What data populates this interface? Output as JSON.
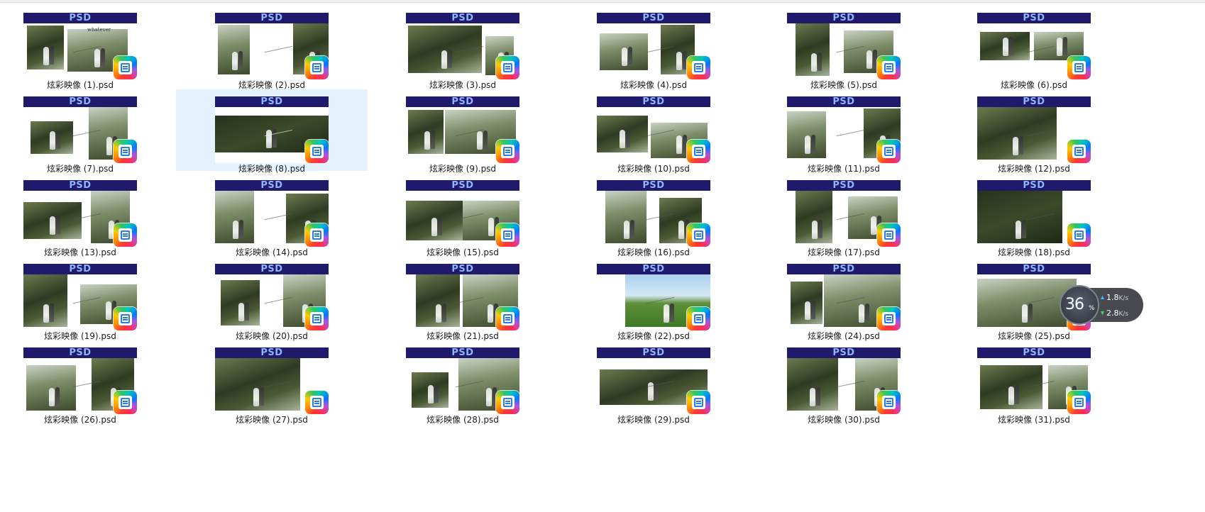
{
  "window": {
    "title": ""
  },
  "files": [
    {
      "name": "炫彩映像 (1).psd",
      "badge": "PSD"
    },
    {
      "name": "炫彩映像 (2).psd",
      "badge": "PSD"
    },
    {
      "name": "炫彩映像 (3).psd",
      "badge": "PSD"
    },
    {
      "name": "炫彩映像 (4).psd",
      "badge": "PSD"
    },
    {
      "name": "炫彩映像 (5).psd",
      "badge": "PSD"
    },
    {
      "name": "炫彩映像 (6).psd",
      "badge": "PSD"
    },
    {
      "name": "炫彩映像 (7).psd",
      "badge": "PSD"
    },
    {
      "name": "炫彩映像 (8).psd",
      "badge": "PSD",
      "selected": true
    },
    {
      "name": "炫彩映像 (9).psd",
      "badge": "PSD"
    },
    {
      "name": "炫彩映像 (10).psd",
      "badge": "PSD"
    },
    {
      "name": "炫彩映像 (11).psd",
      "badge": "PSD"
    },
    {
      "name": "炫彩映像 (12).psd",
      "badge": "PSD"
    },
    {
      "name": "炫彩映像 (13).psd",
      "badge": "PSD"
    },
    {
      "name": "炫彩映像 (14).psd",
      "badge": "PSD"
    },
    {
      "name": "炫彩映像 (15).psd",
      "badge": "PSD"
    },
    {
      "name": "炫彩映像 (16).psd",
      "badge": "PSD"
    },
    {
      "name": "炫彩映像 (17).psd",
      "badge": "PSD"
    },
    {
      "name": "炫彩映像 (18).psd",
      "badge": "PSD"
    },
    {
      "name": "炫彩映像 (19).psd",
      "badge": "PSD"
    },
    {
      "name": "炫彩映像 (20).psd",
      "badge": "PSD"
    },
    {
      "name": "炫彩映像 (21).psd",
      "badge": "PSD"
    },
    {
      "name": "炫彩映像 (22).psd",
      "badge": "PSD"
    },
    {
      "name": "炫彩映像 (24).psd",
      "badge": "PSD"
    },
    {
      "name": "炫彩映像 (25).psd",
      "badge": "PSD"
    },
    {
      "name": "炫彩映像 (26).psd",
      "badge": "PSD"
    },
    {
      "name": "炫彩映像 (27).psd",
      "badge": "PSD"
    },
    {
      "name": "炫彩映像 (28).psd",
      "badge": "PSD"
    },
    {
      "name": "炫彩映像 (29).psd",
      "badge": "PSD"
    },
    {
      "name": "炫彩映像 (30).psd",
      "badge": "PSD"
    },
    {
      "name": "炫彩映像 (31).psd",
      "badge": "PSD"
    }
  ],
  "thumbnail_text": {
    "file_1": "whatever"
  },
  "speed_widget": {
    "percent": "36",
    "percent_sign": "%",
    "upload_value": "1.8",
    "upload_unit": "K/s",
    "download_value": "2.8",
    "download_unit": "K/s"
  },
  "colors": {
    "badge_bg": "#1f1a6b",
    "badge_text": "#8fb4ff",
    "selection_bg": "#e5f3ff",
    "upload_arrow": "#2fb8ff",
    "download_arrow": "#38d27a"
  },
  "icons": {
    "file_type_icon": "image-viewer-app-icon",
    "upload": "arrow-up-icon",
    "download": "arrow-down-icon"
  }
}
